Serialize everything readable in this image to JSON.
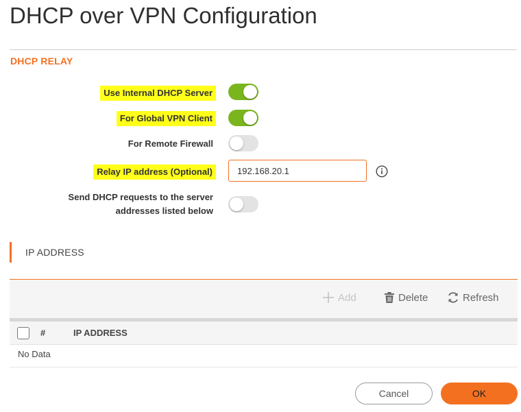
{
  "dialog": {
    "title": "DHCP over VPN Configuration"
  },
  "dhcp_relay": {
    "section_title": "DHCP RELAY",
    "use_internal": {
      "label": "Use Internal DHCP Server",
      "enabled": true
    },
    "global_vpn_client": {
      "label": "For Global VPN Client",
      "enabled": true
    },
    "remote_firewall": {
      "label": "For Remote Firewall",
      "enabled": false
    },
    "relay_ip": {
      "label": "Relay IP address (Optional)",
      "value": "192.168.20.1"
    },
    "send_requests": {
      "label_line1": "Send DHCP requests to the server",
      "label_line2": "addresses listed below",
      "enabled": false
    }
  },
  "ip_address_section": {
    "title": "IP ADDRESS",
    "toolbar": {
      "add_label": "Add",
      "add_icon": "plus-icon",
      "delete_label": "Delete",
      "delete_icon": "trash-icon",
      "refresh_label": "Refresh",
      "refresh_icon": "refresh-icon"
    },
    "table": {
      "columns": [
        "#",
        "IP ADDRESS"
      ],
      "empty_text": "No Data"
    }
  },
  "footer": {
    "cancel_label": "Cancel",
    "ok_label": "OK"
  },
  "colors": {
    "accent": "#f37021",
    "toggle_on": "#7ab51d",
    "highlight": "#ffff1a"
  }
}
